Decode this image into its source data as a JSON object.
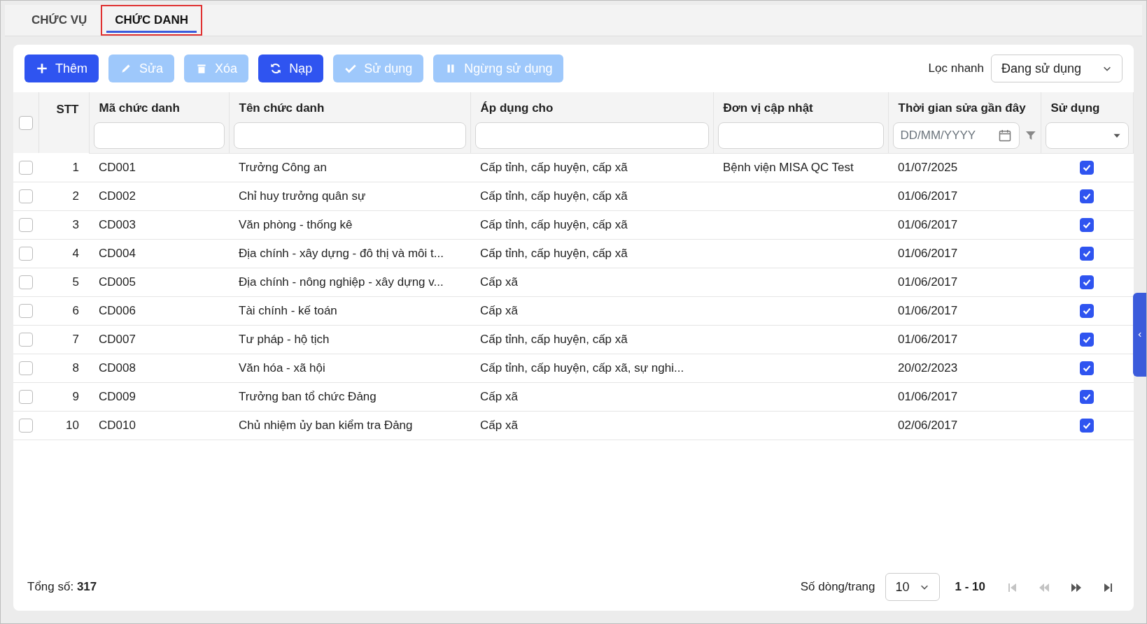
{
  "tabs": [
    {
      "label": "CHỨC VỤ",
      "selected": false
    },
    {
      "label": "CHỨC DANH",
      "selected": true
    }
  ],
  "toolbar": {
    "buttons": [
      {
        "kind": "add",
        "label": "Thêm",
        "disabled": false
      },
      {
        "kind": "edit",
        "label": "Sửa",
        "disabled": true
      },
      {
        "kind": "delete",
        "label": "Xóa",
        "disabled": true
      },
      {
        "kind": "reload",
        "label": "Nạp",
        "disabled": false
      },
      {
        "kind": "activate",
        "label": "Sử dụng",
        "disabled": true
      },
      {
        "kind": "deactivate",
        "label": "Ngừng sử dụng",
        "disabled": true
      }
    ],
    "quick_filter": {
      "label": "Lọc nhanh",
      "value": "Đang sử dụng"
    }
  },
  "table": {
    "select_all": {
      "checked": false
    },
    "columns": [
      "STT",
      "Mã chức danh",
      "Tên chức danh",
      "Áp dụng cho",
      "Đơn vị cập nhật",
      "Thời gian sửa gần đây",
      "Sử dụng"
    ],
    "date_filter": {
      "placeholder": "DD/MM/YYYY"
    },
    "rows": [
      {
        "selected": false,
        "stt": "1",
        "code": "CD001",
        "name": "Trưởng Công an",
        "applies_to": "Cấp tỉnh, cấp huyện, cấp xã",
        "unit": "Bệnh viện MISA QC Test",
        "modified": "01/07/2025",
        "in_use": true
      },
      {
        "selected": false,
        "stt": "2",
        "code": "CD002",
        "name": "Chỉ huy trưởng quân sự",
        "applies_to": "Cấp tỉnh, cấp huyện, cấp xã",
        "modified": "01/06/2017",
        "in_use": true
      },
      {
        "selected": false,
        "stt": "3",
        "code": "CD003",
        "name": "Văn phòng - thống kê",
        "applies_to": "Cấp tỉnh, cấp huyện, cấp xã",
        "modified": "01/06/2017",
        "in_use": true
      },
      {
        "selected": false,
        "stt": "4",
        "code": "CD004",
        "name": "Địa chính - xây dựng - đô thị và môi t...",
        "applies_to": "Cấp tỉnh, cấp huyện, cấp xã",
        "modified": "01/06/2017",
        "in_use": true
      },
      {
        "selected": false,
        "stt": "5",
        "code": "CD005",
        "name": "Địa chính - nông nghiệp - xây dựng v...",
        "applies_to": "Cấp xã",
        "modified": "01/06/2017",
        "in_use": true
      },
      {
        "selected": false,
        "stt": "6",
        "code": "CD006",
        "name": "Tài chính - kế toán",
        "applies_to": "Cấp xã",
        "modified": "01/06/2017",
        "in_use": true
      },
      {
        "selected": false,
        "stt": "7",
        "code": "CD007",
        "name": "Tư pháp - hộ tịch",
        "applies_to": "Cấp tỉnh, cấp huyện, cấp xã",
        "modified": "01/06/2017",
        "in_use": true
      },
      {
        "selected": false,
        "stt": "8",
        "code": "CD008",
        "name": "Văn hóa - xã hội",
        "applies_to": "Cấp tỉnh, cấp huyện, cấp xã, sự nghi...",
        "modified": "20/02/2023",
        "in_use": true
      },
      {
        "selected": false,
        "stt": "9",
        "code": "CD009",
        "name": "Trưởng ban tổ chức Đảng",
        "applies_to": "Cấp xã",
        "modified": "01/06/2017",
        "in_use": true
      },
      {
        "selected": false,
        "stt": "10",
        "code": "CD010",
        "name": "Chủ nhiệm ủy ban kiểm tra Đảng",
        "applies_to": "Cấp xã",
        "modified": "02/06/2017",
        "in_use": true
      }
    ]
  },
  "footer": {
    "total_label": "Tổng số:",
    "total": "317",
    "page_size_label": "Số dòng/trang",
    "page_size": "10",
    "range": "1 - 10",
    "nav": [
      {
        "kind": "first",
        "disabled": true
      },
      {
        "kind": "prev",
        "disabled": true
      },
      {
        "kind": "next",
        "disabled": false
      },
      {
        "kind": "last",
        "disabled": false
      }
    ]
  }
}
